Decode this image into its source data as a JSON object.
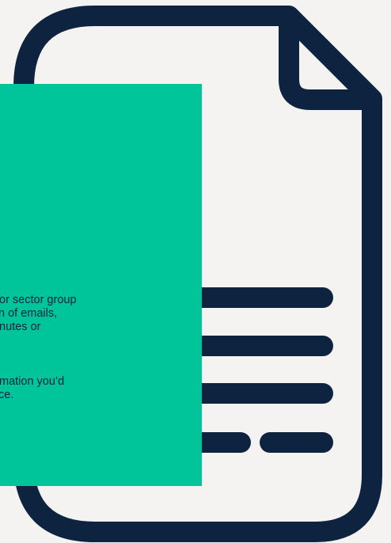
{
  "colors": {
    "background": "#f5f3f2",
    "document_outline": "#0d2340",
    "panel": "#00c49a",
    "text": "#0d2340"
  },
  "icon": "document-icon",
  "panel": {
    "paragraph1": [
      "or sector group",
      "n of emails,",
      "nutes or"
    ],
    "paragraph2": [
      "mation you’d",
      "ce."
    ]
  }
}
